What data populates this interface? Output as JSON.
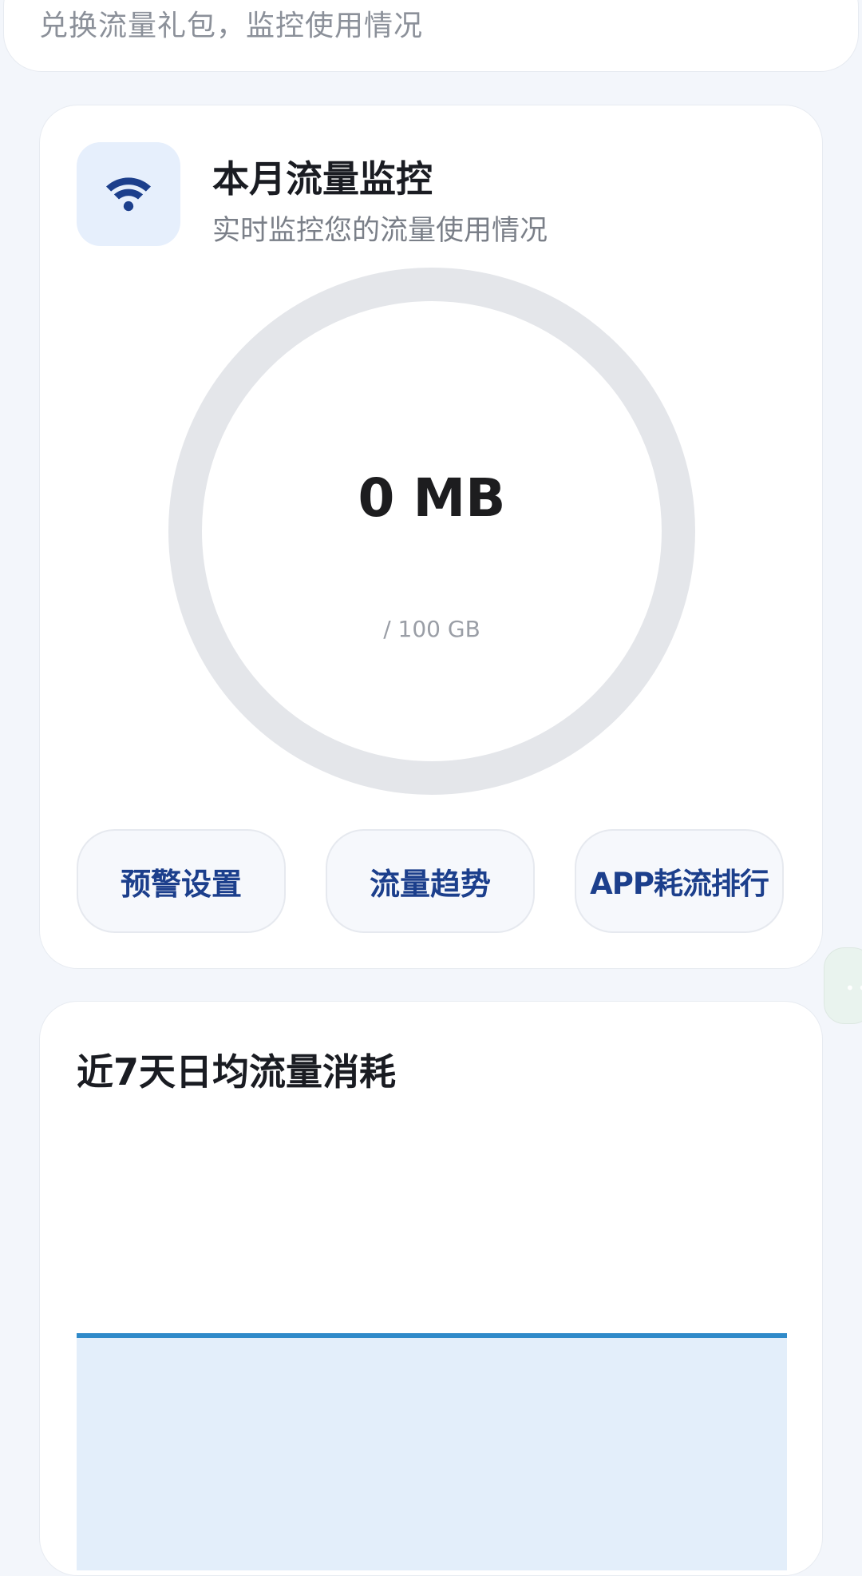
{
  "top_card": {
    "subtitle": "兑换流量礼包，监控使用情况"
  },
  "monitor": {
    "icon": "wifi-icon",
    "title": "本月流量监控",
    "subtitle": "实时监控您的流量使用情况",
    "used": "0 MB",
    "total": "/ 100 GB",
    "used_fraction": 0,
    "ring_track_color": "#e4e6ea",
    "accent_color": "#1c3f8c"
  },
  "actions": {
    "alert_settings": "预警设置",
    "traffic_trend": "流量趋势",
    "app_ranking": "APP耗流排行"
  },
  "floating_handle": {
    "icon": "more-dots-icon"
  },
  "chart": {
    "title": "近7天日均流量消耗",
    "line_color": "#2f8ac9",
    "fill_color": "#e3eefa"
  },
  "chart_data": {
    "type": "area",
    "title": "近7天日均流量消耗",
    "series": [
      {
        "values": [
          0,
          0,
          0,
          0,
          0,
          0,
          0
        ]
      }
    ]
  }
}
